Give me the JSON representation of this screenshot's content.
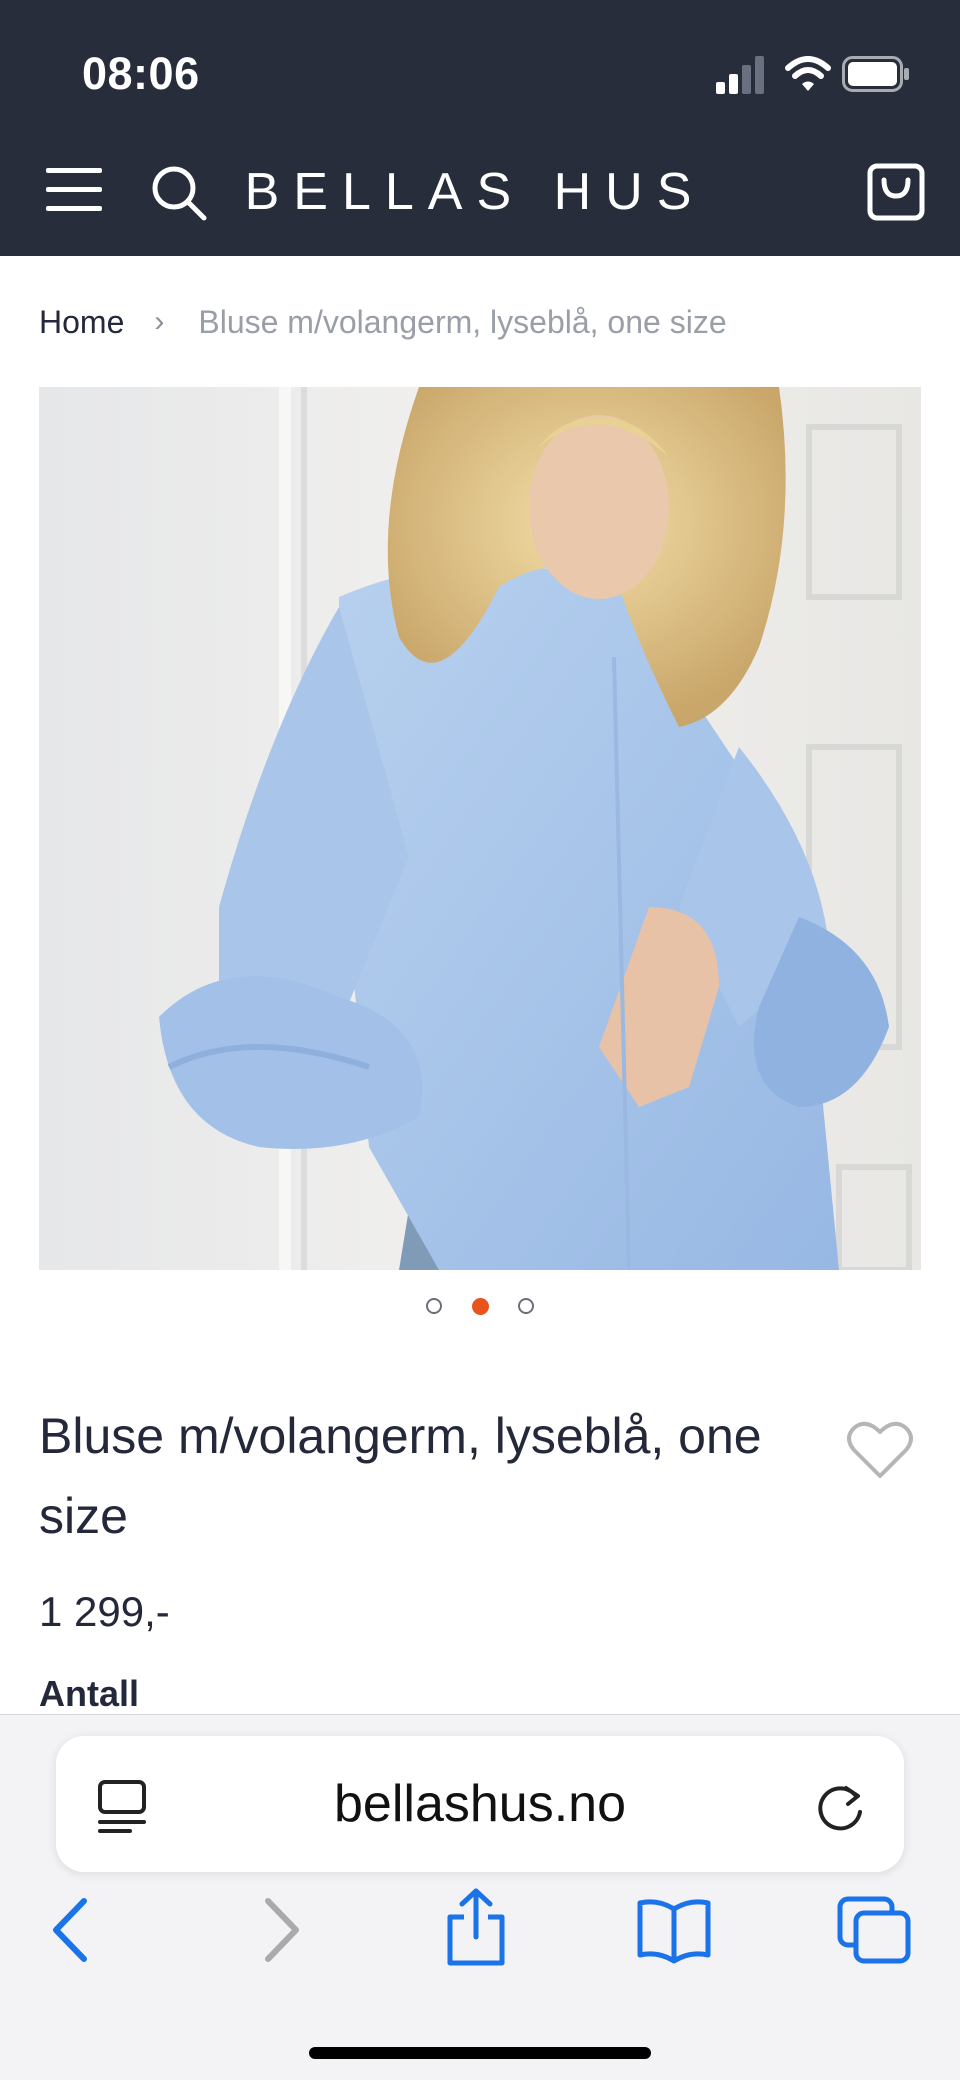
{
  "status_bar": {
    "time": "08:06"
  },
  "header": {
    "brand": "BELLAS HUS",
    "menu_icon": "hamburger-icon",
    "search_icon": "search-icon",
    "cart_icon": "shopping-bag-icon",
    "background_color": "#272d3b"
  },
  "breadcrumb": {
    "home": "Home",
    "separator": "›",
    "current": "Bluse m/volangerm, lyseblå, one size"
  },
  "gallery": {
    "image_subject": "woman in light blue ruffle-sleeve blouse",
    "total_slides": 3,
    "active_slide": 2,
    "active_dot_color": "#e8541c"
  },
  "product": {
    "title": "Bluse m/volangerm, lyseblå, one size",
    "price": "1 299,-",
    "quantity_label": "Antall",
    "wishlist_icon": "heart-icon"
  },
  "browser": {
    "url": "bellashus.no",
    "reader_icon": "reader-mode-icon",
    "reload_icon": "reload-icon",
    "toolbar_icons": [
      "back-icon",
      "forward-icon",
      "share-icon",
      "bookmarks-icon",
      "tabs-icon"
    ],
    "accent_color": "#1a73e8"
  }
}
